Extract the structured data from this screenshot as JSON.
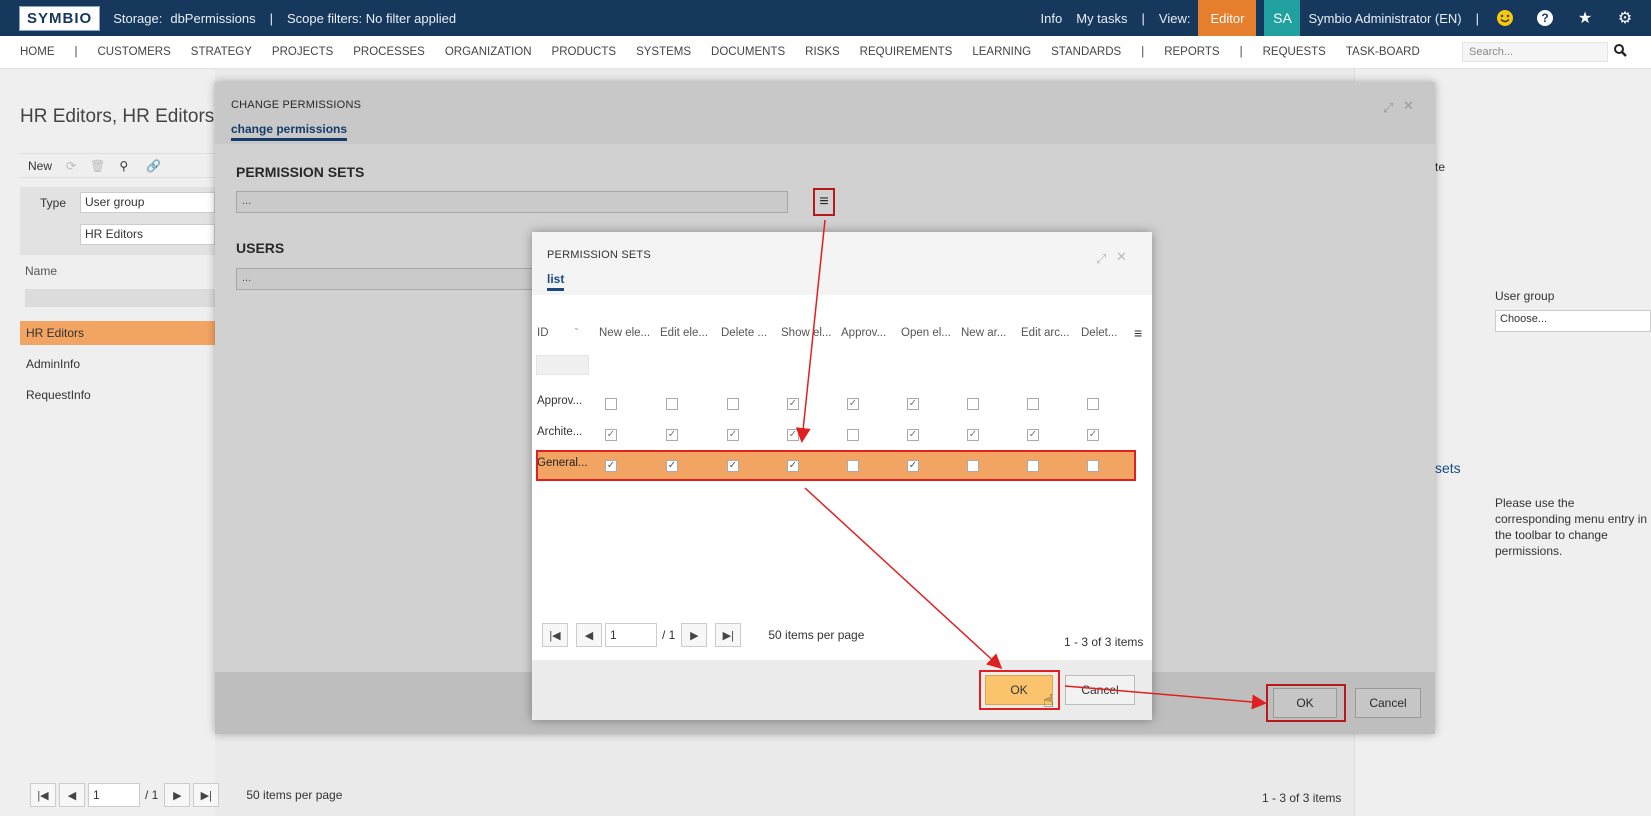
{
  "topbar": {
    "logo": "SYMBIO",
    "storage_label": "Storage:",
    "storage_value": "dbPermissions",
    "separator": "|",
    "scope": "Scope filters: No filter applied",
    "info": "Info",
    "mytasks": "My tasks",
    "view_label": "View:",
    "view_value": "Editor",
    "avatar_initials": "SA",
    "user": "Symbio Administrator (EN)"
  },
  "nav": {
    "items": [
      "HOME",
      "|",
      "CUSTOMERS",
      "STRATEGY",
      "PROJECTS",
      "PROCESSES",
      "ORGANIZATION",
      "PRODUCTS",
      "SYSTEMS",
      "DOCUMENTS",
      "RISKS",
      "REQUIREMENTS",
      "LEARNING",
      "STANDARDS",
      "|",
      "REPORTS",
      "|",
      "REQUESTS",
      "TASK-BOARD"
    ],
    "search_placeholder": "Search..."
  },
  "page": {
    "title": "HR Editors, HR Editors",
    "toolbar_new": "New",
    "type_label": "Type",
    "type_value": "User group",
    "type_value2": "HR Editors",
    "name_label": "Name",
    "list": [
      "HR Editors",
      "AdminInfo",
      "RequestInfo"
    ],
    "pager_page": "1",
    "pager_total": "/ 1",
    "per_page": "50  items per page",
    "items_count": "1 - 3 of 3 items"
  },
  "right_panel": {
    "partial_label": "te",
    "user_group_label": "User group",
    "choose_placeholder": "Choose...",
    "sets_label": "sets",
    "help_text": "Please use the corresponding menu entry in the toolbar to change permissions."
  },
  "change_dialog": {
    "title": "CHANGE PERMISSIONS",
    "tab": "change permissions",
    "perm_sets_heading": "PERMISSION SETS",
    "perm_sets_value": "...",
    "users_heading": "USERS",
    "users_value": "...",
    "ok": "OK",
    "cancel": "Cancel"
  },
  "sets_dialog": {
    "title": "PERMISSION SETS",
    "tab": "list",
    "columns": [
      "ID",
      "New ele...",
      "Edit ele...",
      "Delete ...",
      "Show el...",
      "Approv...",
      "Open el...",
      "New ar...",
      "Edit arc...",
      "Delet..."
    ],
    "rows": [
      {
        "id": "Approv...",
        "checks": [
          false,
          false,
          false,
          true,
          true,
          true,
          false,
          false,
          false
        ]
      },
      {
        "id": "Archite...",
        "checks": [
          true,
          true,
          true,
          true,
          false,
          true,
          true,
          true,
          true
        ]
      },
      {
        "id": "General...",
        "checks": [
          true,
          true,
          true,
          true,
          false,
          true,
          false,
          false,
          false
        ]
      }
    ],
    "pager_page": "1",
    "pager_total": "/ 1",
    "per_page": "50  items per page",
    "items_count": "1 - 3 of 3 items",
    "ok": "OK",
    "cancel": "Cancel"
  },
  "colors": {
    "topbar": "#16385d",
    "accent": "#e57f2d",
    "selection": "#f2a462",
    "ok_button": "#fbc36b",
    "highlight": "#e02020"
  }
}
